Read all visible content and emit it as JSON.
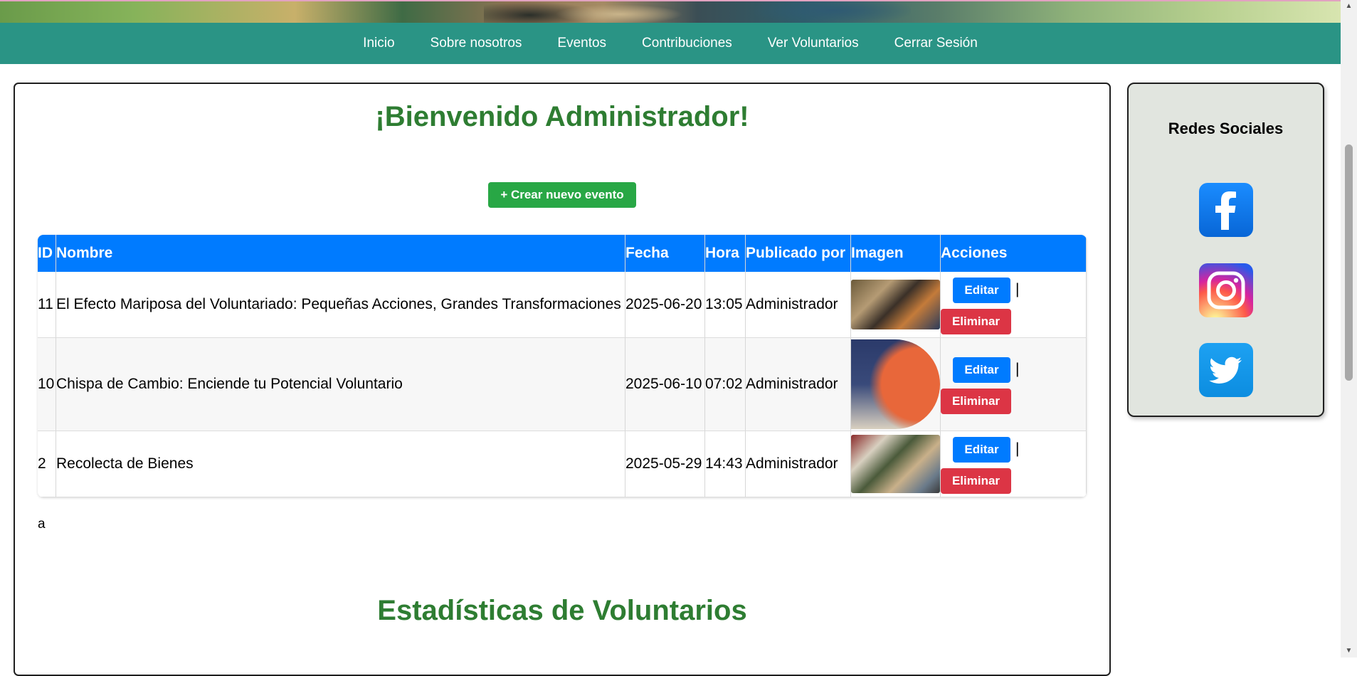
{
  "nav": {
    "items": [
      "Inicio",
      "Sobre nosotros",
      "Eventos",
      "Contribuciones",
      "Ver Voluntarios",
      "Cerrar Sesión"
    ]
  },
  "main": {
    "welcome": "¡Bienvenido Administrador!",
    "create_button": "+ Crear nuevo evento",
    "table": {
      "headers": [
        "ID",
        "Nombre",
        "Fecha",
        "Hora",
        "Publicado por",
        "Imagen",
        "Acciones"
      ],
      "rows": [
        {
          "id": "11",
          "nombre": "El Efecto Mariposa del Voluntariado: Pequeñas Acciones, Grandes Transformaciones",
          "fecha": "2025-06-20",
          "hora": "13:05",
          "publicado": "Administrador"
        },
        {
          "id": "10",
          "nombre": "Chispa de Cambio: Enciende tu Potencial Voluntario",
          "fecha": "2025-06-10",
          "hora": "07:02",
          "publicado": "Administrador"
        },
        {
          "id": "2",
          "nombre": "Recolecta de Bienes",
          "fecha": "2025-05-29",
          "hora": "14:43",
          "publicado": "Administrador"
        }
      ],
      "edit_label": "Editar",
      "delete_label": "Eliminar",
      "separator": "|"
    },
    "stray_text": "a",
    "stats_title": "Estadísticas de Voluntarios"
  },
  "social": {
    "title": "Redes Sociales",
    "icons": [
      "facebook-icon",
      "instagram-icon",
      "twitter-icon"
    ]
  },
  "colors": {
    "nav_bg": "#2a9485",
    "heading_green": "#2e7d32",
    "table_header": "#007bff",
    "create_button": "#28a745",
    "edit_button": "#007bff",
    "delete_button": "#dc3545",
    "social_panel_bg": "#e1e5df"
  }
}
